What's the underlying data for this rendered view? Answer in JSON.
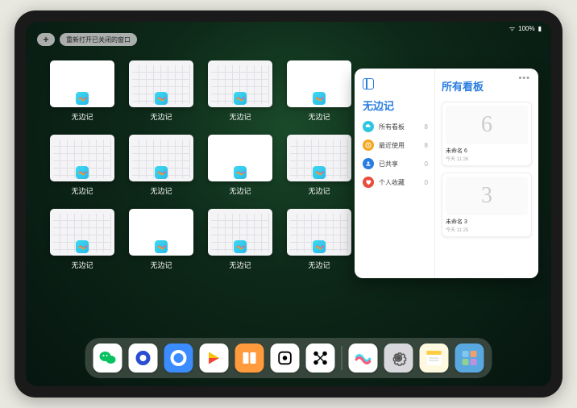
{
  "status": {
    "battery": "100%",
    "signal": "wifi"
  },
  "controls": {
    "plus": "+",
    "reopen_label": "重新打开已关闭的窗口"
  },
  "app_name": "无边记",
  "windows": [
    {
      "label": "无边记",
      "style": "blank"
    },
    {
      "label": "无边记",
      "style": "cal"
    },
    {
      "label": "无边记",
      "style": "cal"
    },
    {
      "label": "无边记",
      "style": "blank"
    },
    {
      "label": "无边记",
      "style": "cal"
    },
    {
      "label": "无边记",
      "style": "cal"
    },
    {
      "label": "无边记",
      "style": "blank"
    },
    {
      "label": "无边记",
      "style": "cal"
    },
    {
      "label": "无边记",
      "style": "cal"
    },
    {
      "label": "无边记",
      "style": "blank"
    },
    {
      "label": "无边记",
      "style": "cal"
    },
    {
      "label": "无边记",
      "style": "cal"
    }
  ],
  "expanded": {
    "title": "无边记",
    "right_title": "所有看板",
    "items": [
      {
        "icon": "cloud",
        "color": "#2fc5e0",
        "label": "所有看板",
        "count": "8"
      },
      {
        "icon": "clock",
        "color": "#f5a623",
        "label": "最近使用",
        "count": "8"
      },
      {
        "icon": "person",
        "color": "#2a7de0",
        "label": "已共享",
        "count": "0"
      },
      {
        "icon": "heart",
        "color": "#e84c3d",
        "label": "个人收藏",
        "count": "0"
      }
    ],
    "boards": [
      {
        "digit": "6",
        "name": "未命名 6",
        "date": "今天 11:26"
      },
      {
        "digit": "3",
        "name": "未命名 3",
        "date": "今天 11:25"
      }
    ]
  },
  "dock": [
    {
      "name": "wechat",
      "bg": "#ffffff",
      "glyph": "wechat"
    },
    {
      "name": "browser1",
      "bg": "#ffffff",
      "glyph": "o-blue"
    },
    {
      "name": "browser2",
      "bg": "#3b8cff",
      "glyph": "o-white"
    },
    {
      "name": "play",
      "bg": "#ffffff",
      "glyph": "play"
    },
    {
      "name": "books",
      "bg": "#ff9a3d",
      "glyph": "books"
    },
    {
      "name": "dice",
      "bg": "#ffffff",
      "glyph": "dice"
    },
    {
      "name": "nodes",
      "bg": "#ffffff",
      "glyph": "nodes"
    },
    {
      "name": "freeform",
      "bg": "#ffffff",
      "glyph": "freeform"
    },
    {
      "name": "settings",
      "bg": "#d8d8dc",
      "glyph": "gear"
    },
    {
      "name": "notes",
      "bg": "#fff9e0",
      "glyph": "notes"
    },
    {
      "name": "applib",
      "bg": "#5aa8e0",
      "glyph": "grid"
    }
  ]
}
